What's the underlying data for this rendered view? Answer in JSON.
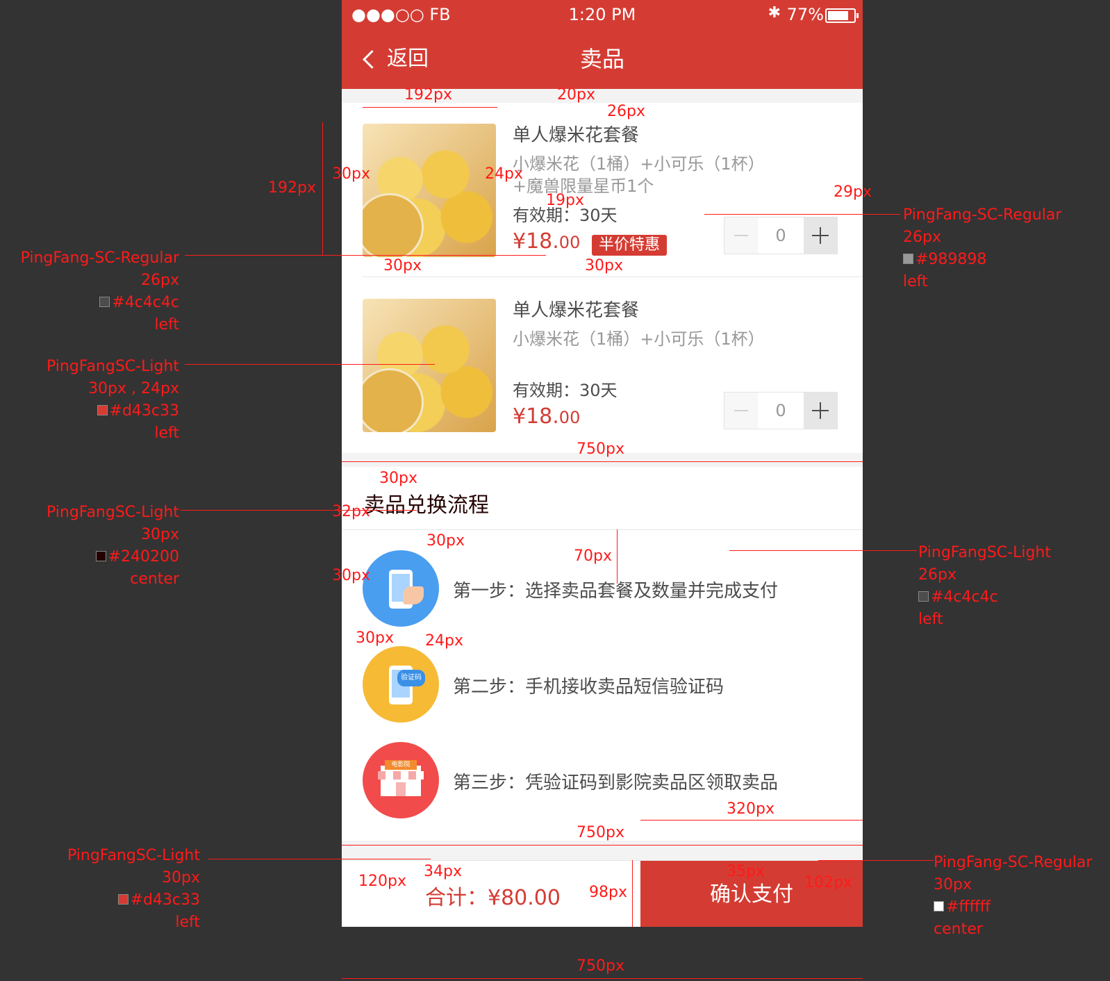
{
  "status_bar": {
    "carrier": "●●●○○ FB",
    "time": "1:20 PM",
    "battery": "77%",
    "bluetooth": "✱"
  },
  "nav": {
    "back_label": "返回",
    "title": "卖品"
  },
  "products": [
    {
      "name": "单人爆米花套餐",
      "desc": "小爆米花（1桶）+小可乐（1杯）+魔兽限量星币1个",
      "validity": "有效期：30天",
      "price_int": "¥18.",
      "price_dec": "00",
      "tag": "半价特惠",
      "quantity": "0"
    },
    {
      "name": "单人爆米花套餐",
      "desc": "小爆米花（1桶）+小可乐（1杯）",
      "validity": "有效期：30天",
      "price_int": "¥18.",
      "price_dec": "00",
      "tag": "",
      "quantity": "0"
    }
  ],
  "flow": {
    "title": "卖品兑换流程",
    "steps": [
      {
        "label": "第一步：选择卖品套餐及数量并完成支付",
        "icon": "phone-tap-icon"
      },
      {
        "label": "第二步：手机接收卖品短信验证码",
        "icon": "sms-code-icon",
        "icon_text": "验证码"
      },
      {
        "label": "第三步：凭验证码到影院卖品区领取卖品",
        "icon": "cinema-shop-icon",
        "icon_text": "电影院"
      }
    ]
  },
  "footer": {
    "total": "合计：¥80.00",
    "pay_button": "确认支付"
  },
  "annotations": {
    "left1": {
      "font": "PingFang-SC-Regular",
      "size": "26px",
      "color_label": "#4c4c4c",
      "align": "left",
      "swatch": "#4c4c4c"
    },
    "left2": {
      "font": "PingFangSC-Light",
      "size": "30px , 24px",
      "color_label": "#d43c33",
      "align": "left",
      "swatch": "#d43c33"
    },
    "left3": {
      "font": "PingFangSC-Light",
      "size": "30px",
      "color_label": "#240200",
      "align": "center",
      "swatch": "#240200"
    },
    "left4": {
      "font": "PingFangSC-Light",
      "size": "30px",
      "color_label": "#d43c33",
      "align": "left",
      "swatch": "#d43c33"
    },
    "right1": {
      "font": "PingFang-SC-Regular",
      "size": "26px",
      "color_label": "#989898",
      "align": "left",
      "swatch": "#989898"
    },
    "right2": {
      "font": "PingFangSC-Light",
      "size": "26px",
      "color_label": "#4c4c4c",
      "align": "left",
      "swatch": "#4c4c4c"
    },
    "right3": {
      "font": "PingFang-SC-Regular",
      "size": "30px",
      "color_label": "#ffffff",
      "align": "center",
      "swatch": "#ffffff"
    }
  },
  "dimensions": {
    "d192w": "192px",
    "d20": "20px",
    "d26": "26px",
    "d192h": "192px",
    "d30a": "30px",
    "d24a": "24px",
    "d19": "19px",
    "d29": "29px",
    "d30b": "30px",
    "d30c": "30px",
    "d750a": "750px",
    "d30d": "30px",
    "d32": "32px",
    "d30e": "30px",
    "d70": "70px",
    "d30f": "30px",
    "d30g": "30px",
    "d24b": "24px",
    "d320": "320px",
    "d750b": "750px",
    "d34": "34px",
    "d120": "120px",
    "d98": "98px",
    "d35": "35px",
    "d102": "102px",
    "d750c": "750px"
  }
}
